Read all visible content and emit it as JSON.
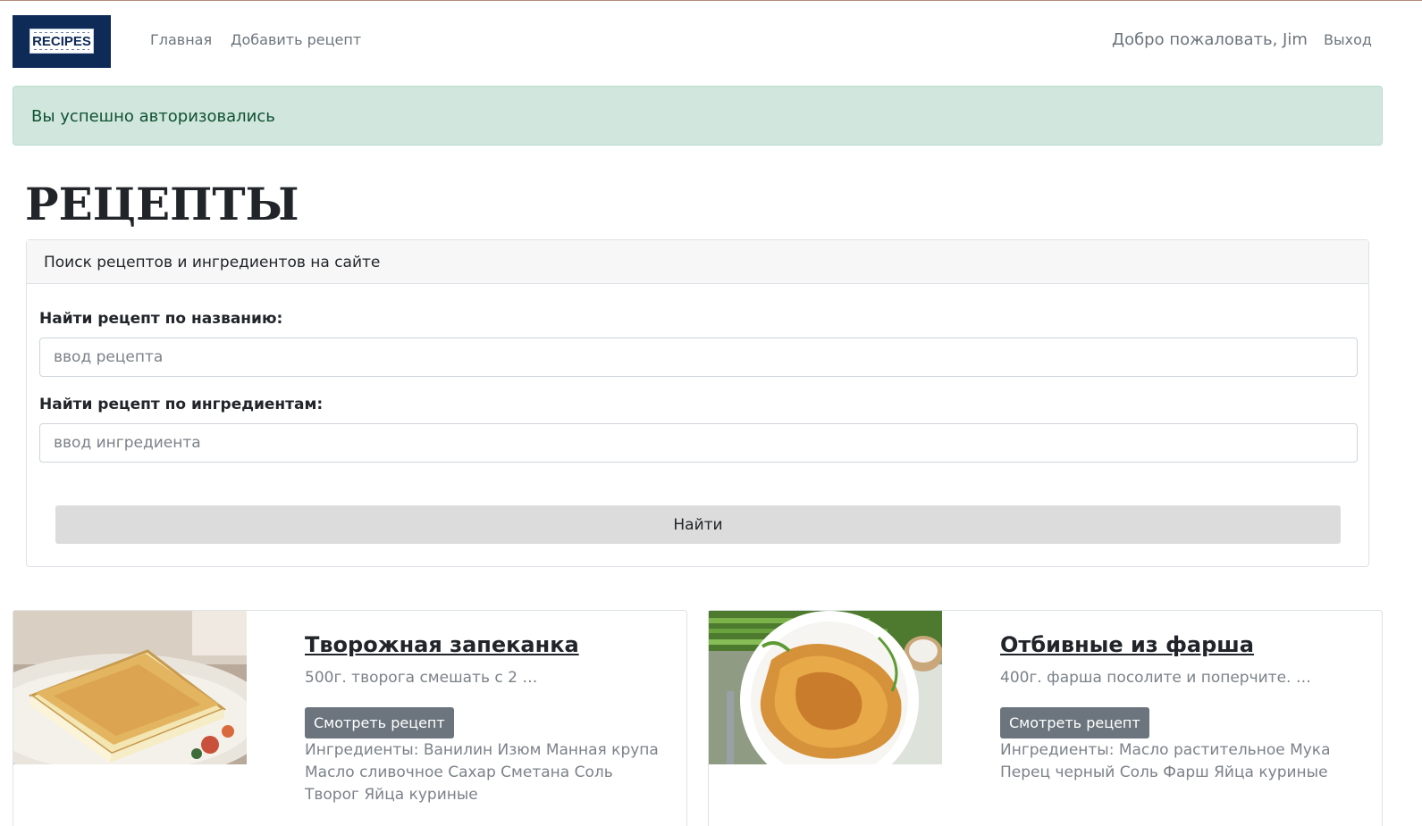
{
  "navbar": {
    "logo_text": "RECIPES",
    "links": {
      "home": "Главная",
      "add_recipe": "Добавить рецепт"
    },
    "welcome": "Добро пожаловать, Jim",
    "logout": "Выход"
  },
  "alert": {
    "text": "Вы успешно авторизовались",
    "color": "#d1e7dd"
  },
  "page": {
    "title": "РЕЦЕПТЫ"
  },
  "search": {
    "header": "Поиск рецептов и ингредиентов на сайте",
    "name_label": "Найти рецепт по названию:",
    "name_placeholder": "ввод рецепта",
    "name_value": "",
    "ingredients_label": "Найти рецепт по ингредиентам:",
    "ingredients_placeholder": "ввод ингредиента",
    "ingredients_value": "",
    "submit": "Найти"
  },
  "recipes": [
    {
      "title": "Творожная запеканка",
      "description": "500г. творога смешать с 2 …",
      "button": "Смотреть рецепт",
      "ingredients": "Ингредиенты: Ванилин Изюм Манная крупа Масло сливочное Сахар Сметана Соль Творог Яйца куриные"
    },
    {
      "title": "Отбивные из фарша",
      "description": "400г. фарша посолите и поперчите. …",
      "button": "Смотреть рецепт",
      "ingredients": "Ингредиенты: Масло растительное Мука Перец черный Соль Фарш Яйца куриные"
    }
  ]
}
